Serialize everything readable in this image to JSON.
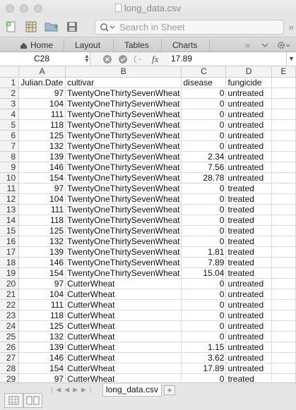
{
  "window": {
    "title": "long_data.csv"
  },
  "toolbar": {
    "search_placeholder": "Search in Sheet"
  },
  "ribbon": {
    "tabs": [
      "Home",
      "Layout",
      "Tables",
      "Charts"
    ],
    "overflow": "»"
  },
  "formula_bar": {
    "cell_ref": "C28",
    "fx": "fx",
    "value": "17.89"
  },
  "columns": [
    "A",
    "B",
    "C",
    "D",
    "E"
  ],
  "rows": [
    {
      "n": "1",
      "a": "Julian.Date",
      "b": "cultivar",
      "c": "disease",
      "d": "fungicide",
      "header": true
    },
    {
      "n": "2",
      "a": "97",
      "b": "TwentyOneThirtySevenWheat",
      "c": "0",
      "d": "untreated"
    },
    {
      "n": "3",
      "a": "104",
      "b": "TwentyOneThirtySevenWheat",
      "c": "0",
      "d": "untreated"
    },
    {
      "n": "4",
      "a": "111",
      "b": "TwentyOneThirtySevenWheat",
      "c": "0",
      "d": "untreated"
    },
    {
      "n": "5",
      "a": "118",
      "b": "TwentyOneThirtySevenWheat",
      "c": "0",
      "d": "untreated"
    },
    {
      "n": "6",
      "a": "125",
      "b": "TwentyOneThirtySevenWheat",
      "c": "0",
      "d": "untreated"
    },
    {
      "n": "7",
      "a": "132",
      "b": "TwentyOneThirtySevenWheat",
      "c": "0",
      "d": "untreated"
    },
    {
      "n": "8",
      "a": "139",
      "b": "TwentyOneThirtySevenWheat",
      "c": "2.34",
      "d": "untreated"
    },
    {
      "n": "9",
      "a": "146",
      "b": "TwentyOneThirtySevenWheat",
      "c": "7.56",
      "d": "untreated"
    },
    {
      "n": "10",
      "a": "154",
      "b": "TwentyOneThirtySevenWheat",
      "c": "28.78",
      "d": "untreated"
    },
    {
      "n": "11",
      "a": "97",
      "b": "TwentyOneThirtySevenWheat",
      "c": "0",
      "d": "treated"
    },
    {
      "n": "12",
      "a": "104",
      "b": "TwentyOneThirtySevenWheat",
      "c": "0",
      "d": "treated"
    },
    {
      "n": "13",
      "a": "111",
      "b": "TwentyOneThirtySevenWheat",
      "c": "0",
      "d": "treated"
    },
    {
      "n": "14",
      "a": "118",
      "b": "TwentyOneThirtySevenWheat",
      "c": "0",
      "d": "treated"
    },
    {
      "n": "15",
      "a": "125",
      "b": "TwentyOneThirtySevenWheat",
      "c": "0",
      "d": "treated"
    },
    {
      "n": "16",
      "a": "132",
      "b": "TwentyOneThirtySevenWheat",
      "c": "0",
      "d": "treated"
    },
    {
      "n": "17",
      "a": "139",
      "b": "TwentyOneThirtySevenWheat",
      "c": "1.81",
      "d": "treated"
    },
    {
      "n": "18",
      "a": "146",
      "b": "TwentyOneThirtySevenWheat",
      "c": "7.89",
      "d": "treated"
    },
    {
      "n": "19",
      "a": "154",
      "b": "TwentyOneThirtySevenWheat",
      "c": "15.04",
      "d": "treated"
    },
    {
      "n": "20",
      "a": "97",
      "b": "CutterWheat",
      "c": "0",
      "d": "untreated"
    },
    {
      "n": "21",
      "a": "104",
      "b": "CutterWheat",
      "c": "0",
      "d": "untreated"
    },
    {
      "n": "22",
      "a": "111",
      "b": "CutterWheat",
      "c": "0",
      "d": "untreated"
    },
    {
      "n": "23",
      "a": "118",
      "b": "CutterWheat",
      "c": "0",
      "d": "untreated"
    },
    {
      "n": "24",
      "a": "125",
      "b": "CutterWheat",
      "c": "0",
      "d": "untreated"
    },
    {
      "n": "25",
      "a": "132",
      "b": "CutterWheat",
      "c": "0",
      "d": "untreated"
    },
    {
      "n": "26",
      "a": "139",
      "b": "CutterWheat",
      "c": "1.15",
      "d": "untreated"
    },
    {
      "n": "27",
      "a": "146",
      "b": "CutterWheat",
      "c": "3.62",
      "d": "untreated"
    },
    {
      "n": "28",
      "a": "154",
      "b": "CutterWheat",
      "c": "17.89",
      "d": "untreated"
    },
    {
      "n": "29",
      "a": "97",
      "b": "CutterWheat",
      "c": "0",
      "d": "treated"
    }
  ],
  "sheet_tabs": [
    {
      "label": "long_data.csv"
    }
  ],
  "add_sheet": "+"
}
